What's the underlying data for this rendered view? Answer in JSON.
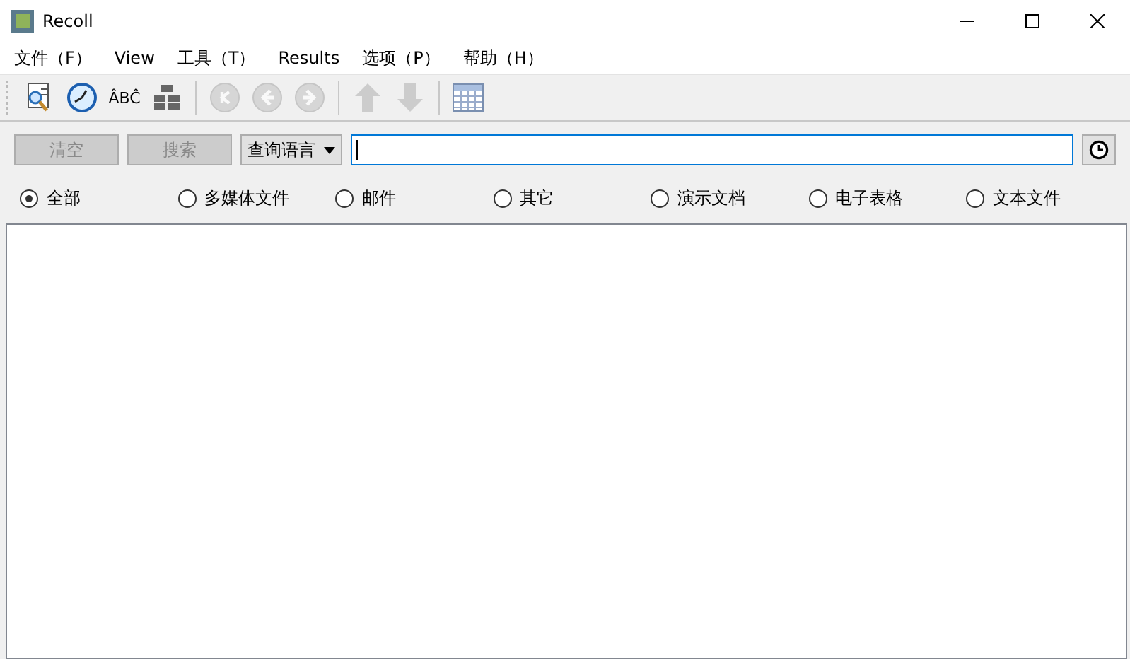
{
  "window": {
    "title": "Recoll"
  },
  "menu": [
    "文件（F）",
    "View",
    "工具（T）",
    "Results",
    "选项（P）",
    "帮助（H）"
  ],
  "toolbar": [
    {
      "kind": "search-doc",
      "disabled": false
    },
    {
      "kind": "clock",
      "disabled": false
    },
    {
      "kind": "spell",
      "label": "ÂBĈ",
      "disabled": false
    },
    {
      "kind": "blocks",
      "disabled": false
    },
    {
      "kind": "sep"
    },
    {
      "kind": "first",
      "disabled": true
    },
    {
      "kind": "prev",
      "disabled": true
    },
    {
      "kind": "next",
      "disabled": true
    },
    {
      "kind": "sep"
    },
    {
      "kind": "up",
      "disabled": true
    },
    {
      "kind": "down",
      "disabled": true
    },
    {
      "kind": "sep"
    },
    {
      "kind": "table",
      "disabled": false
    }
  ],
  "search": {
    "clear_button": {
      "label": "清空",
      "disabled": true
    },
    "search_button": {
      "label": "搜索",
      "disabled": true
    },
    "query_language": "查询语言"
  },
  "filters": [
    {
      "label": "全部",
      "selected": true
    },
    {
      "label": "多媒体文件",
      "selected": false
    },
    {
      "label": "邮件",
      "selected": false
    },
    {
      "label": "其它",
      "selected": false
    },
    {
      "label": "演示文档",
      "selected": false
    },
    {
      "label": "电子表格",
      "selected": false
    },
    {
      "label": "文本文件",
      "selected": false
    }
  ]
}
